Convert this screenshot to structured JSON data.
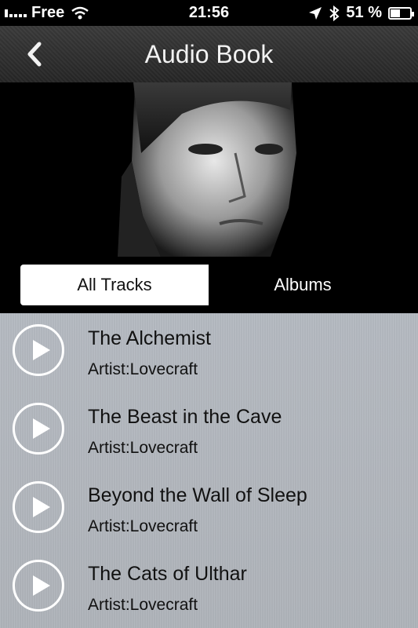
{
  "status_bar": {
    "carrier": "Free",
    "time": "21:56",
    "battery": "51 %",
    "battery_level": 0.51
  },
  "navbar": {
    "title": "Audio Book",
    "back_icon": "chevron-left-icon"
  },
  "tabs": {
    "all_tracks": "All Tracks",
    "albums": "Albums",
    "selected": "All Tracks"
  },
  "tracks": [
    {
      "title": "The Alchemist",
      "artist": "Artist:Lovecraft"
    },
    {
      "title": "The Beast in the Cave",
      "artist": "Artist:Lovecraft"
    },
    {
      "title": "Beyond the Wall of Sleep",
      "artist": "Artist:Lovecraft"
    },
    {
      "title": "The Cats of Ulthar",
      "artist": "Artist:Lovecraft"
    }
  ]
}
